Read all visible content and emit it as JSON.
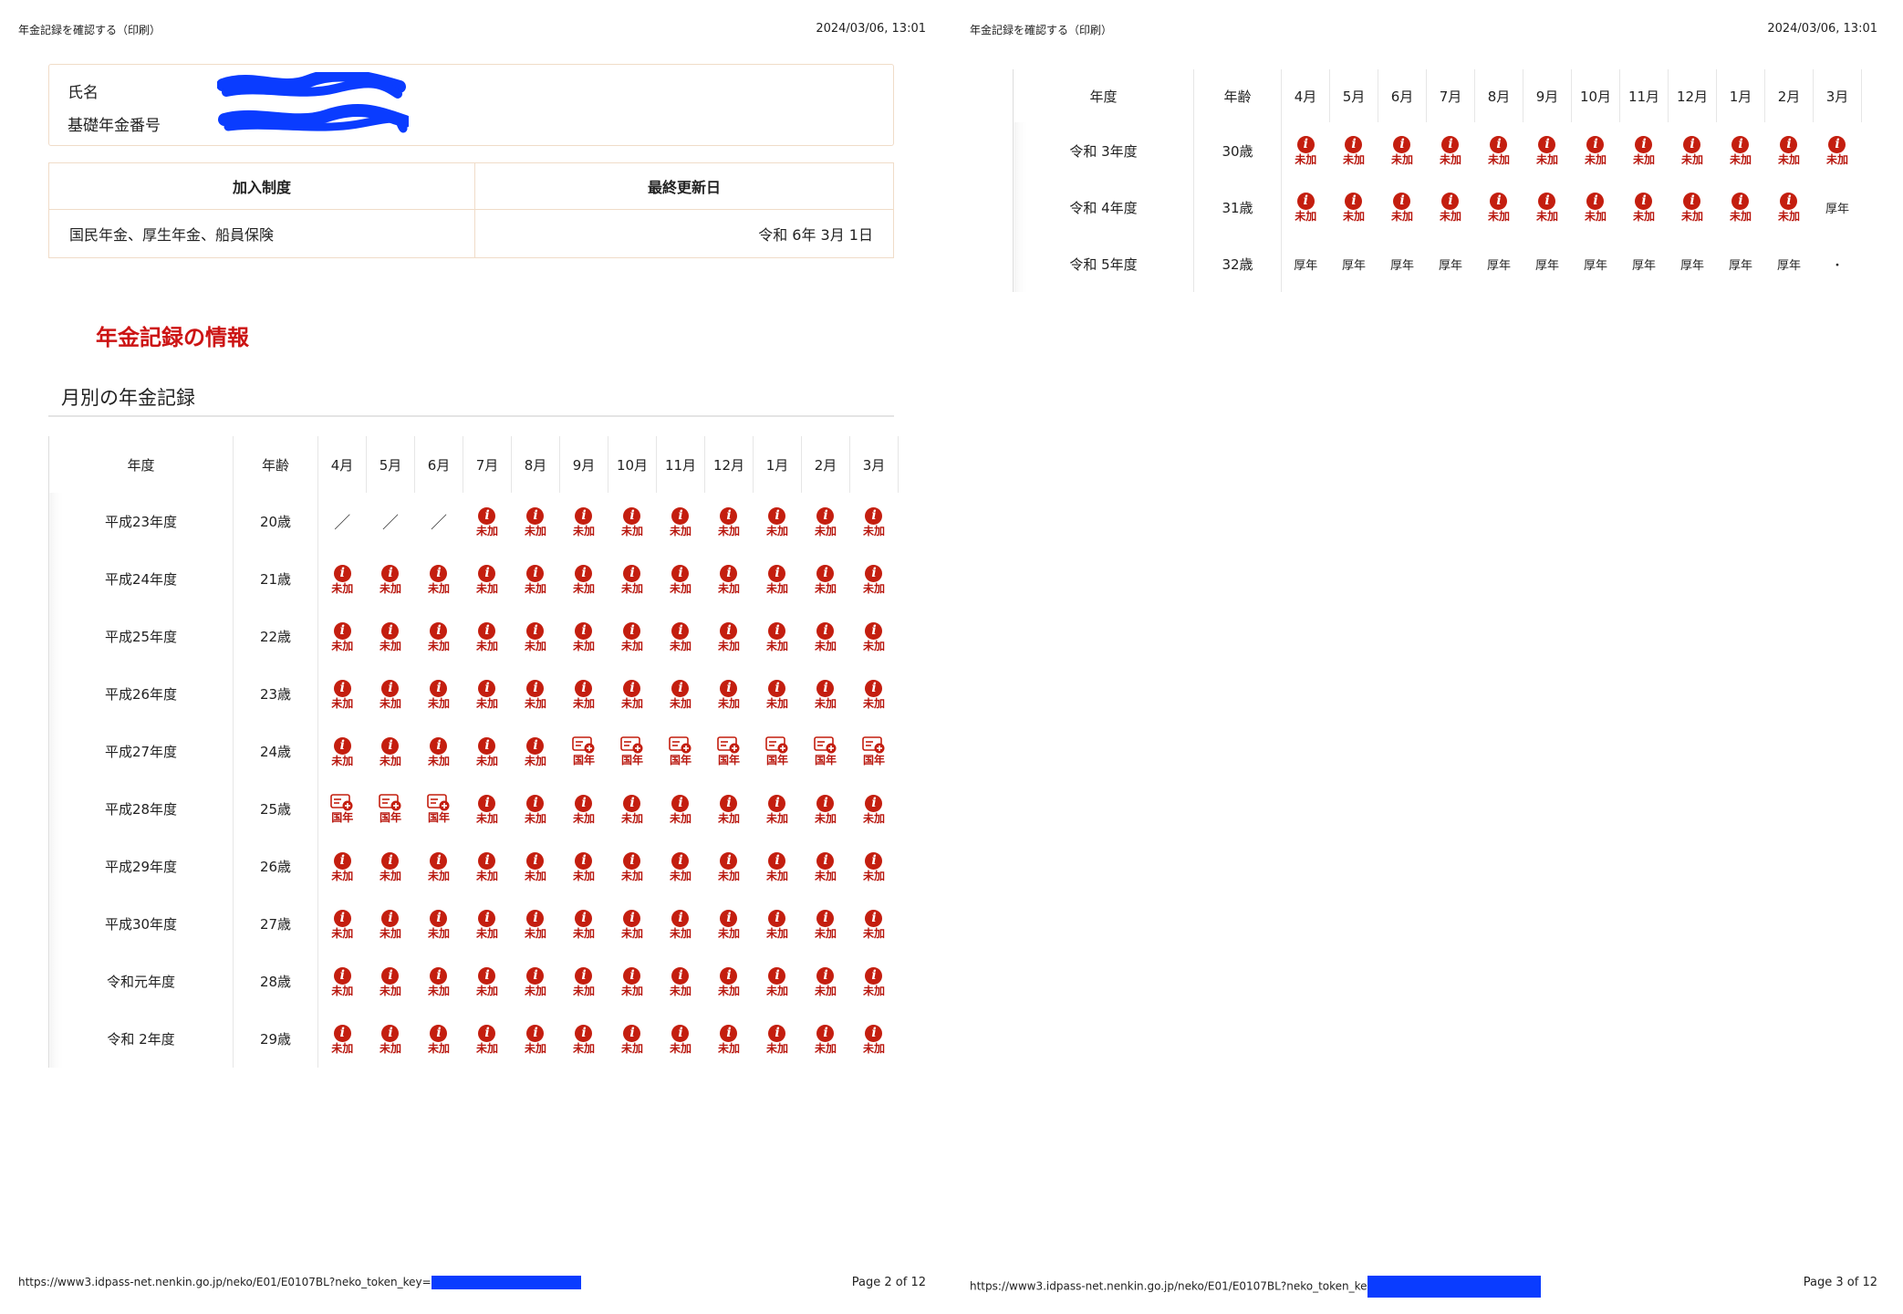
{
  "pages": [
    {
      "header_title": "年金記録を確認する（印刷）",
      "header_datetime": "2024/03/06, 13:01",
      "footer_url": "https://www3.idpass-net.nenkin.go.jp/neko/E01/E0107BL?neko_token_key=",
      "footer_page": "Page 2 of 12"
    },
    {
      "header_title": "年金記録を確認する（印刷）",
      "header_datetime": "2024/03/06, 13:01",
      "footer_url": "https://www3.idpass-net.nenkin.go.jp/neko/E01/E0107BL?neko_token_ke",
      "footer_page": "Page 3 of 12"
    }
  ],
  "person": {
    "name_label": "氏名",
    "pension_number_label": "基礎年金番号"
  },
  "system_table": {
    "header_system": "加入制度",
    "header_updated": "最終更新日",
    "systems": "国民年金、厚生年金、船員保険",
    "updated": "令和 6年 3月 1日"
  },
  "section_title": "年金記録の情報",
  "subsection_title": "月別の年金記録",
  "grid_headers": {
    "year": "年度",
    "age": "年齢",
    "months": [
      "4月",
      "5月",
      "6月",
      "7月",
      "8月",
      "9月",
      "10月",
      "11月",
      "12月",
      "1月",
      "2月",
      "3月"
    ]
  },
  "status_labels": {
    "u": "未加",
    "k": "国年",
    "kc": "厚年",
    "s": "／",
    "d": "・"
  },
  "icons": {
    "u": "info-icon",
    "k": "pension-card-icon"
  },
  "colors": {
    "accent_red": "#c41e0f",
    "label_red": "#b8160d",
    "redaction_blue": "#0a3cff"
  },
  "left_rows": [
    {
      "year": "平成23年度",
      "age": "20歳",
      "cells": [
        "s",
        "s",
        "s",
        "u",
        "u",
        "u",
        "u",
        "u",
        "u",
        "u",
        "u",
        "u"
      ]
    },
    {
      "year": "平成24年度",
      "age": "21歳",
      "cells": [
        "u",
        "u",
        "u",
        "u",
        "u",
        "u",
        "u",
        "u",
        "u",
        "u",
        "u",
        "u"
      ]
    },
    {
      "year": "平成25年度",
      "age": "22歳",
      "cells": [
        "u",
        "u",
        "u",
        "u",
        "u",
        "u",
        "u",
        "u",
        "u",
        "u",
        "u",
        "u"
      ]
    },
    {
      "year": "平成26年度",
      "age": "23歳",
      "cells": [
        "u",
        "u",
        "u",
        "u",
        "u",
        "u",
        "u",
        "u",
        "u",
        "u",
        "u",
        "u"
      ]
    },
    {
      "year": "平成27年度",
      "age": "24歳",
      "cells": [
        "u",
        "u",
        "u",
        "u",
        "u",
        "k",
        "k",
        "k",
        "k",
        "k",
        "k",
        "k"
      ]
    },
    {
      "year": "平成28年度",
      "age": "25歳",
      "cells": [
        "k",
        "k",
        "k",
        "u",
        "u",
        "u",
        "u",
        "u",
        "u",
        "u",
        "u",
        "u"
      ]
    },
    {
      "year": "平成29年度",
      "age": "26歳",
      "cells": [
        "u",
        "u",
        "u",
        "u",
        "u",
        "u",
        "u",
        "u",
        "u",
        "u",
        "u",
        "u"
      ]
    },
    {
      "year": "平成30年度",
      "age": "27歳",
      "cells": [
        "u",
        "u",
        "u",
        "u",
        "u",
        "u",
        "u",
        "u",
        "u",
        "u",
        "u",
        "u"
      ]
    },
    {
      "year": "令和元年度",
      "age": "28歳",
      "cells": [
        "u",
        "u",
        "u",
        "u",
        "u",
        "u",
        "u",
        "u",
        "u",
        "u",
        "u",
        "u"
      ]
    },
    {
      "year": "令和 2年度",
      "age": "29歳",
      "cells": [
        "u",
        "u",
        "u",
        "u",
        "u",
        "u",
        "u",
        "u",
        "u",
        "u",
        "u",
        "u"
      ]
    }
  ],
  "right_rows": [
    {
      "year": "令和 3年度",
      "age": "30歳",
      "cells": [
        "u",
        "u",
        "u",
        "u",
        "u",
        "u",
        "u",
        "u",
        "u",
        "u",
        "u",
        "u"
      ]
    },
    {
      "year": "令和 4年度",
      "age": "31歳",
      "cells": [
        "u",
        "u",
        "u",
        "u",
        "u",
        "u",
        "u",
        "u",
        "u",
        "u",
        "u",
        "kc"
      ]
    },
    {
      "year": "令和 5年度",
      "age": "32歳",
      "cells": [
        "kc",
        "kc",
        "kc",
        "kc",
        "kc",
        "kc",
        "kc",
        "kc",
        "kc",
        "kc",
        "kc",
        "d"
      ]
    }
  ]
}
